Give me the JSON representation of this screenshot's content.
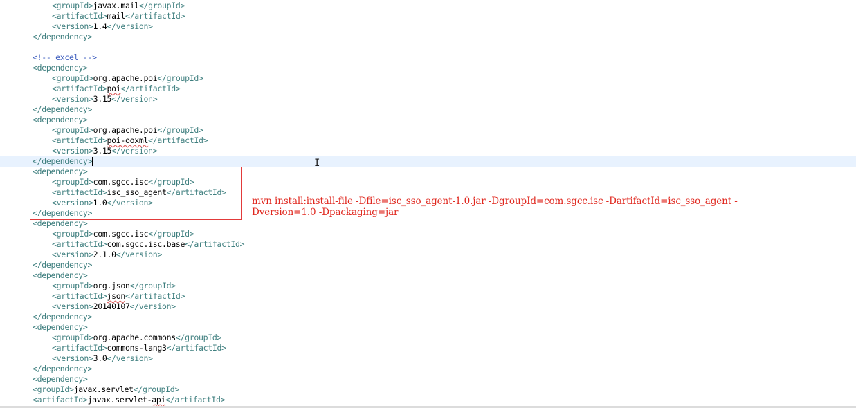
{
  "editor": {
    "lines": [
      {
        "t": "open",
        "name": "groupId",
        "value": "javax.mail"
      },
      {
        "t": "open",
        "name": "artifactId",
        "value": "mail"
      },
      {
        "t": "open",
        "name": "version",
        "value": "1.4"
      },
      {
        "t": "close",
        "text": "</dependency>"
      },
      {
        "t": "blank"
      },
      {
        "t": "comment",
        "text": "<!-- excel -->"
      },
      {
        "t": "close",
        "text": "<dependency>"
      },
      {
        "t": "open",
        "name": "groupId",
        "value": "org.apache.poi"
      },
      {
        "t": "open",
        "name": "artifactId",
        "value": "poi",
        "squiggle": true
      },
      {
        "t": "open",
        "name": "version",
        "value": "3.15"
      },
      {
        "t": "close",
        "text": "</dependency>"
      },
      {
        "t": "close",
        "text": "<dependency>"
      },
      {
        "t": "open",
        "name": "groupId",
        "value": "org.apache.poi"
      },
      {
        "t": "open",
        "name": "artifactId",
        "value": "poi-ooxml",
        "squiggle": true
      },
      {
        "t": "open",
        "name": "version",
        "value": "3.15"
      },
      {
        "t": "close",
        "text": "</dependency>",
        "current": true
      },
      {
        "t": "close",
        "text": "<dependency>"
      },
      {
        "t": "open",
        "name": "groupId",
        "value": "com.sgcc.isc"
      },
      {
        "t": "open",
        "name": "artifactId",
        "value": "isc_sso_agent"
      },
      {
        "t": "open",
        "name": "version",
        "value": "1.0"
      },
      {
        "t": "close",
        "text": "</dependency>"
      },
      {
        "t": "close",
        "text": "<dependency>"
      },
      {
        "t": "open",
        "name": "groupId",
        "value": "com.sgcc.isc"
      },
      {
        "t": "open",
        "name": "artifactId",
        "value": "com.sgcc.isc.base"
      },
      {
        "t": "open",
        "name": "version",
        "value": "2.1.0"
      },
      {
        "t": "close",
        "text": "</dependency>"
      },
      {
        "t": "close",
        "text": "<dependency>"
      },
      {
        "t": "open",
        "name": "groupId",
        "value": "org.json"
      },
      {
        "t": "open",
        "name": "artifactId",
        "value": "json",
        "squiggle": true
      },
      {
        "t": "open",
        "name": "version",
        "value": "20140107"
      },
      {
        "t": "close",
        "text": "</dependency>"
      },
      {
        "t": "close",
        "text": "<dependency>"
      },
      {
        "t": "open",
        "name": "groupId",
        "value": "org.apache.commons"
      },
      {
        "t": "open",
        "name": "artifactId",
        "value": "commons-lang3"
      },
      {
        "t": "open",
        "name": "version",
        "value": "3.0"
      },
      {
        "t": "close",
        "text": "</dependency>"
      },
      {
        "t": "close",
        "text": "<dependency>"
      },
      {
        "t": "open",
        "name": "groupId",
        "value": "javax.servlet",
        "outdent": true
      },
      {
        "t": "open",
        "name": "artifactId",
        "value": "javax.servlet-api",
        "outdent": true,
        "squiggle_tail": "api"
      }
    ]
  },
  "annotation": {
    "line1": "mvn install:install-file -Dfile=isc_sso_agent-1.0.jar -DgroupId=com.sgcc.isc -DartifactId=isc_sso_agent -",
    "line2": "Dversion=1.0 -Dpackaging=jar"
  }
}
